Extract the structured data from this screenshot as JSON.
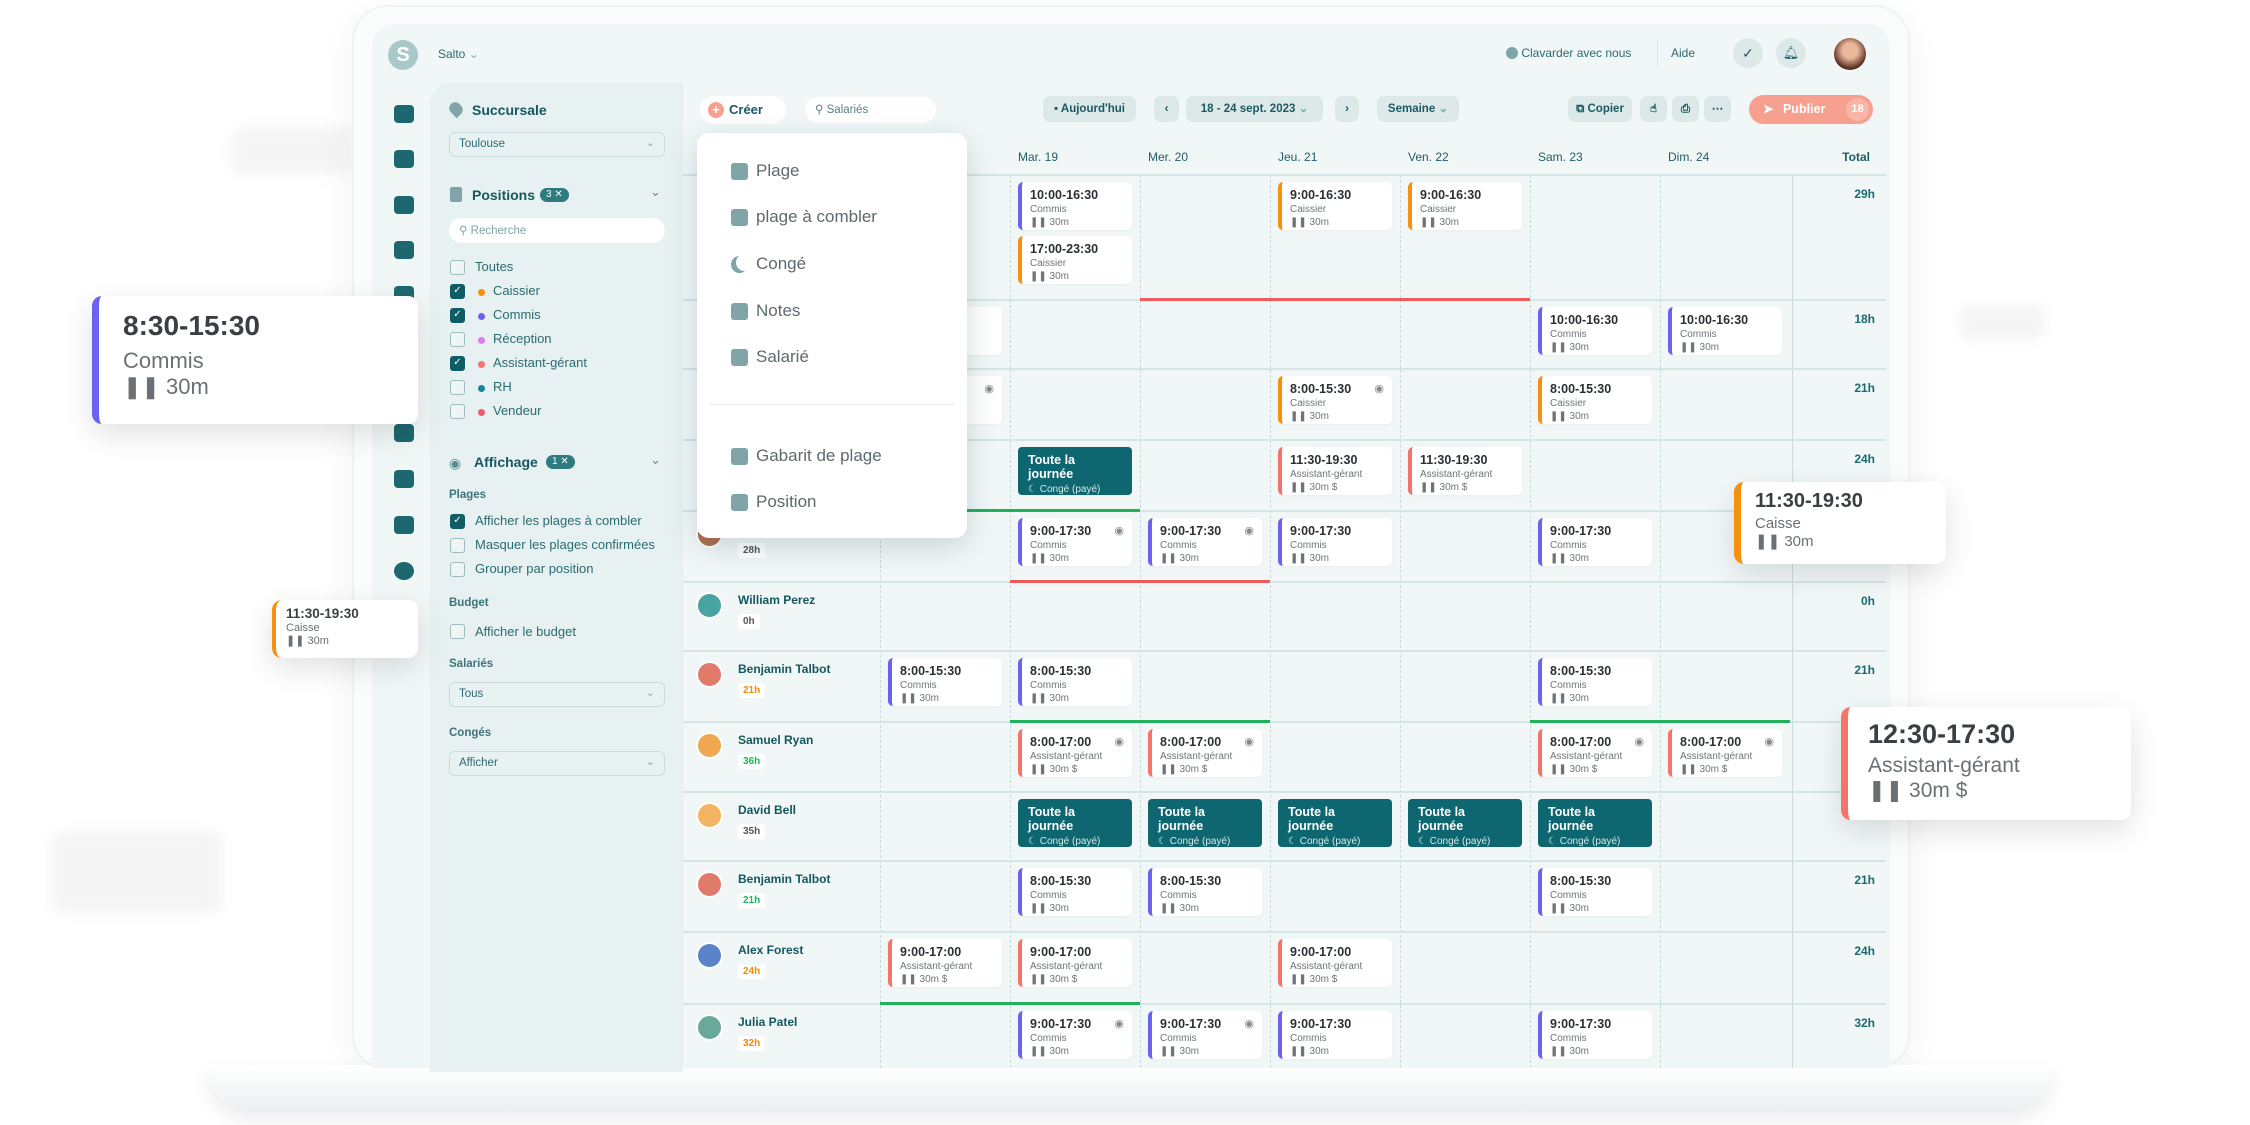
{
  "colors": {
    "commis": "#6b63ef",
    "caissier": "#f7900e",
    "assistant": "#f4736b",
    "conge": "#0e6670",
    "publish": "#f7a08f",
    "brand": "#0f5e66"
  },
  "topbar": {
    "logo": "S",
    "org": "Salto",
    "chat": "Clavarder avec nous",
    "help": "Aide"
  },
  "rail": [
    "home-icon",
    "schedule-icon",
    "timeclock-icon",
    "team-icon",
    "tasks-icon",
    "reports-icon",
    "groups-icon",
    "billing-icon",
    "gear-icon"
  ],
  "sidebar": {
    "branch_title": "Succursale",
    "branch_value": "Toulouse",
    "positions_title": "Positions",
    "positions_badge": "3 ✕",
    "search_placeholder": "Recherche",
    "positions": [
      {
        "label": "Toutes",
        "checked": false,
        "color": ""
      },
      {
        "label": "Caissier",
        "checked": true,
        "color": "#f7900e"
      },
      {
        "label": "Commis",
        "checked": true,
        "color": "#6b63ef"
      },
      {
        "label": "Réception",
        "checked": false,
        "color": "#e07cf0"
      },
      {
        "label": "Assistant-gérant",
        "checked": true,
        "color": "#f4736b"
      },
      {
        "label": "RH",
        "checked": false,
        "color": "#17869a"
      },
      {
        "label": "Vendeur",
        "checked": false,
        "color": "#ee5a6e"
      }
    ],
    "display_title": "Affichage",
    "display_badge": "1 ✕",
    "shifts_label": "Plages",
    "shift_options": [
      {
        "label": "Afficher les plages à combler",
        "checked": true
      },
      {
        "label": "Masquer les plages confirmées",
        "checked": false
      },
      {
        "label": "Grouper par position",
        "checked": false
      }
    ],
    "budget_label": "Budget",
    "budget_option": {
      "label": "Afficher le budget",
      "checked": false
    },
    "employees_label": "Salariés",
    "employees_value": "Tous",
    "leave_label": "Congés",
    "leave_value": "Afficher"
  },
  "toolbar": {
    "create": "Créer",
    "search_placeholder": "Salariés",
    "today": "Aujourd'hui",
    "range": "18 - 24 sept. 2023",
    "view": "Semaine",
    "copy": "Copier",
    "publish": "Publier",
    "publish_count": "18"
  },
  "create_menu": {
    "items": [
      {
        "label": "Plage",
        "icon": "shift-add-icon"
      },
      {
        "label": "plage à combler",
        "icon": "calendar-add-icon"
      },
      {
        "label": "Congé",
        "icon": "moon-icon"
      },
      {
        "label": "Notes",
        "icon": "note-icon"
      },
      {
        "label": "Salarié",
        "icon": "user-add-icon"
      }
    ],
    "items2": [
      {
        "label": "Gabarit de plage",
        "icon": "template-icon"
      },
      {
        "label": "Position",
        "icon": "badge-icon"
      }
    ]
  },
  "days": [
    "",
    "Mar. 19",
    "Mer. 20",
    "Jeu. 21",
    "Ven. 22",
    "Sam. 23",
    "Dim. 24"
  ],
  "total_label": "Total",
  "rows": [
    {
      "name": "",
      "hours": "",
      "badge_color": "",
      "avatar": "",
      "total": "29h",
      "shifts": [
        [
          1,
          "10:00-16:30",
          "Commis",
          "30m",
          "commis",
          false
        ],
        [
          1,
          "17:00-23:30",
          "Caissier",
          "30m",
          "caissier",
          false
        ],
        [
          3,
          "9:00-16:30",
          "Caissier",
          "30m",
          "caissier",
          false
        ],
        [
          4,
          "9:00-16:30",
          "Caissier",
          "30m",
          "caissier",
          false
        ]
      ],
      "leave": []
    },
    {
      "name": "",
      "hours": "",
      "badge_color": "",
      "avatar": "",
      "total": "18h",
      "shifts": [
        [
          5,
          "10:00-16:30",
          "Commis",
          "30m",
          "commis",
          false
        ],
        [
          6,
          "10:00-16:30",
          "Commis",
          "30m",
          "commis",
          false
        ]
      ],
      "leave": []
    },
    {
      "name": "",
      "hours": "",
      "badge_color": "",
      "avatar": "",
      "total": "21h",
      "shifts": [
        [
          3,
          "8:00-15:30",
          "Caissier",
          "30m",
          "caissier",
          true
        ],
        [
          5,
          "8:00-15:30",
          "Caissier",
          "30m",
          "caissier",
          false
        ]
      ],
      "leave": []
    },
    {
      "name": "",
      "hours": "",
      "badge_color": "",
      "avatar": "",
      "total": "24h",
      "shifts": [
        [
          3,
          "11:30-19:30",
          "Assistant-gérant",
          "30m $",
          "assistant",
          false
        ],
        [
          4,
          "11:30-19:30",
          "Assistant-gérant",
          "30m $",
          "assistant",
          false
        ]
      ],
      "leave": [
        1
      ]
    },
    {
      "name": "",
      "hours": "28h",
      "badge_color": "#555",
      "avatar": "#b07050",
      "total": "",
      "shifts": [
        [
          1,
          "9:00-17:30",
          "Commis",
          "30m",
          "commis",
          true
        ],
        [
          2,
          "9:00-17:30",
          "Commis",
          "30m",
          "commis",
          true
        ],
        [
          3,
          "9:00-17:30",
          "Commis",
          "30m",
          "commis",
          false
        ],
        [
          5,
          "9:00-17:30",
          "Commis",
          "30m",
          "commis",
          false
        ]
      ],
      "leave": []
    },
    {
      "name": "William Perez",
      "hours": "0h",
      "badge_color": "#555",
      "avatar": "#4aa3a3",
      "total": "0h",
      "shifts": [],
      "leave": []
    },
    {
      "name": "Benjamin Talbot",
      "hours": "21h",
      "badge_color": "#f08a00",
      "avatar": "#e07a6a",
      "total": "21h",
      "shifts": [
        [
          0,
          "8:00-15:30",
          "Commis",
          "30m",
          "commis",
          false
        ],
        [
          1,
          "8:00-15:30",
          "Commis",
          "30m",
          "commis",
          false
        ],
        [
          5,
          "8:00-15:30",
          "Commis",
          "30m",
          "commis",
          false
        ]
      ],
      "leave": []
    },
    {
      "name": "Samuel Ryan",
      "hours": "36h",
      "badge_color": "#1fb35a",
      "avatar": "#f0a850",
      "total": "",
      "shifts": [
        [
          1,
          "8:00-17:00",
          "Assistant-gérant",
          "30m $",
          "assistant",
          true
        ],
        [
          2,
          "8:00-17:00",
          "Assistant-gérant",
          "30m $",
          "assistant",
          true
        ],
        [
          5,
          "8:00-17:00",
          "Assistant-gérant",
          "30m $",
          "assistant",
          true
        ],
        [
          6,
          "8:00-17:00",
          "Assistant-gérant",
          "30m $",
          "assistant",
          true
        ]
      ],
      "leave": []
    },
    {
      "name": "David Bell",
      "hours": "35h",
      "badge_color": "#555",
      "avatar": "#f3b562",
      "total": "",
      "shifts": [],
      "leave": [
        1,
        2,
        3,
        4,
        5
      ]
    },
    {
      "name": "Benjamin Talbot",
      "hours": "21h",
      "badge_color": "#1fb35a",
      "avatar": "#e07a6a",
      "total": "21h",
      "shifts": [
        [
          1,
          "8:00-15:30",
          "Commis",
          "30m",
          "commis",
          false
        ],
        [
          2,
          "8:00-15:30",
          "Commis",
          "30m",
          "commis",
          false
        ],
        [
          5,
          "8:00-15:30",
          "Commis",
          "30m",
          "commis",
          false
        ]
      ],
      "leave": []
    },
    {
      "name": "Alex Forest",
      "hours": "24h",
      "badge_color": "#f08a00",
      "avatar": "#5b84c8",
      "total": "24h",
      "shifts": [
        [
          0,
          "9:00-17:00",
          "Assistant-gérant",
          "30m $",
          "assistant",
          false
        ],
        [
          1,
          "9:00-17:00",
          "Assistant-gérant",
          "30m $",
          "assistant",
          false
        ],
        [
          3,
          "9:00-17:00",
          "Assistant-gérant",
          "30m $",
          "assistant",
          false
        ]
      ],
      "leave": []
    },
    {
      "name": "Julia Patel",
      "hours": "32h",
      "badge_color": "#f08a00",
      "avatar": "#6aa89a",
      "total": "32h",
      "shifts": [
        [
          1,
          "9:00-17:30",
          "Commis",
          "30m",
          "commis",
          true
        ],
        [
          2,
          "9:00-17:30",
          "Commis",
          "30m",
          "commis",
          true
        ],
        [
          3,
          "9:00-17:30",
          "Commis",
          "30m",
          "commis",
          false
        ],
        [
          5,
          "9:00-17:30",
          "Commis",
          "30m",
          "commis",
          false
        ]
      ],
      "leave": []
    }
  ],
  "leave_card": {
    "title": "Toute la journée",
    "subtitle": "Congé (payé)"
  },
  "floating_cards": [
    {
      "time": "8:30-15:30",
      "position": "Commis",
      "break": "30m",
      "color": "#6b63ef"
    },
    {
      "time": "11:30-19:30",
      "position": "Caisse",
      "break": "30m",
      "color": "#f7900e"
    },
    {
      "time": "11:30-19:30",
      "position": "Caisse",
      "break": "30m",
      "color": "#f7900e"
    },
    {
      "time": "12:30-17:30",
      "position": "Assistant-gérant",
      "break": "30m $",
      "color": "#f4736b"
    }
  ]
}
